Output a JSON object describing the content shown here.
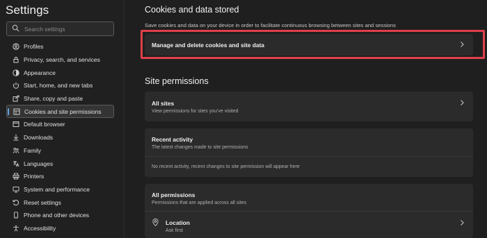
{
  "sidebar": {
    "title": "Settings",
    "search": {
      "placeholder": "Search settings"
    },
    "items": [
      {
        "label": "Profiles",
        "icon": "profile-icon"
      },
      {
        "label": "Privacy, search, and services",
        "icon": "lock-icon"
      },
      {
        "label": "Appearance",
        "icon": "appearance-icon"
      },
      {
        "label": "Start, home, and new tabs",
        "icon": "power-icon"
      },
      {
        "label": "Share, copy and paste",
        "icon": "share-icon"
      },
      {
        "label": "Cookies and site permissions",
        "icon": "cookies-icon",
        "active": true
      },
      {
        "label": "Default browser",
        "icon": "browser-icon"
      },
      {
        "label": "Downloads",
        "icon": "download-icon"
      },
      {
        "label": "Family",
        "icon": "family-icon"
      },
      {
        "label": "Languages",
        "icon": "languages-icon"
      },
      {
        "label": "Printers",
        "icon": "printer-icon"
      },
      {
        "label": "System and performance",
        "icon": "system-icon"
      },
      {
        "label": "Reset settings",
        "icon": "reset-icon"
      },
      {
        "label": "Phone and other devices",
        "icon": "phone-icon"
      },
      {
        "label": "Accessibility",
        "icon": "accessibility-icon"
      }
    ]
  },
  "main": {
    "cookies": {
      "title": "Cookies and data stored",
      "description": "Save cookies and data on your device in order to facilitate continuous browsing between sites and sessions",
      "manage_label": "Manage and delete cookies and site data"
    },
    "site_permissions": {
      "title": "Site permissions",
      "all_sites": {
        "title": "All sites",
        "subtitle": "View permissions for sites you've visited"
      },
      "recent_activity": {
        "title": "Recent activity",
        "subtitle": "The latest changes made to site permissions",
        "empty_text": "No recent activity, recent changes to site permission will appear here"
      },
      "all_permissions": {
        "title": "All permissions",
        "subtitle": "Permissions that are applied across all sites",
        "location": {
          "title": "Location",
          "subtitle": "Ask first"
        }
      }
    }
  },
  "colors": {
    "background": "#1f1f1f",
    "card": "#2b2b2b",
    "highlight": "#e0404a",
    "accent": "#6aa0e0"
  }
}
